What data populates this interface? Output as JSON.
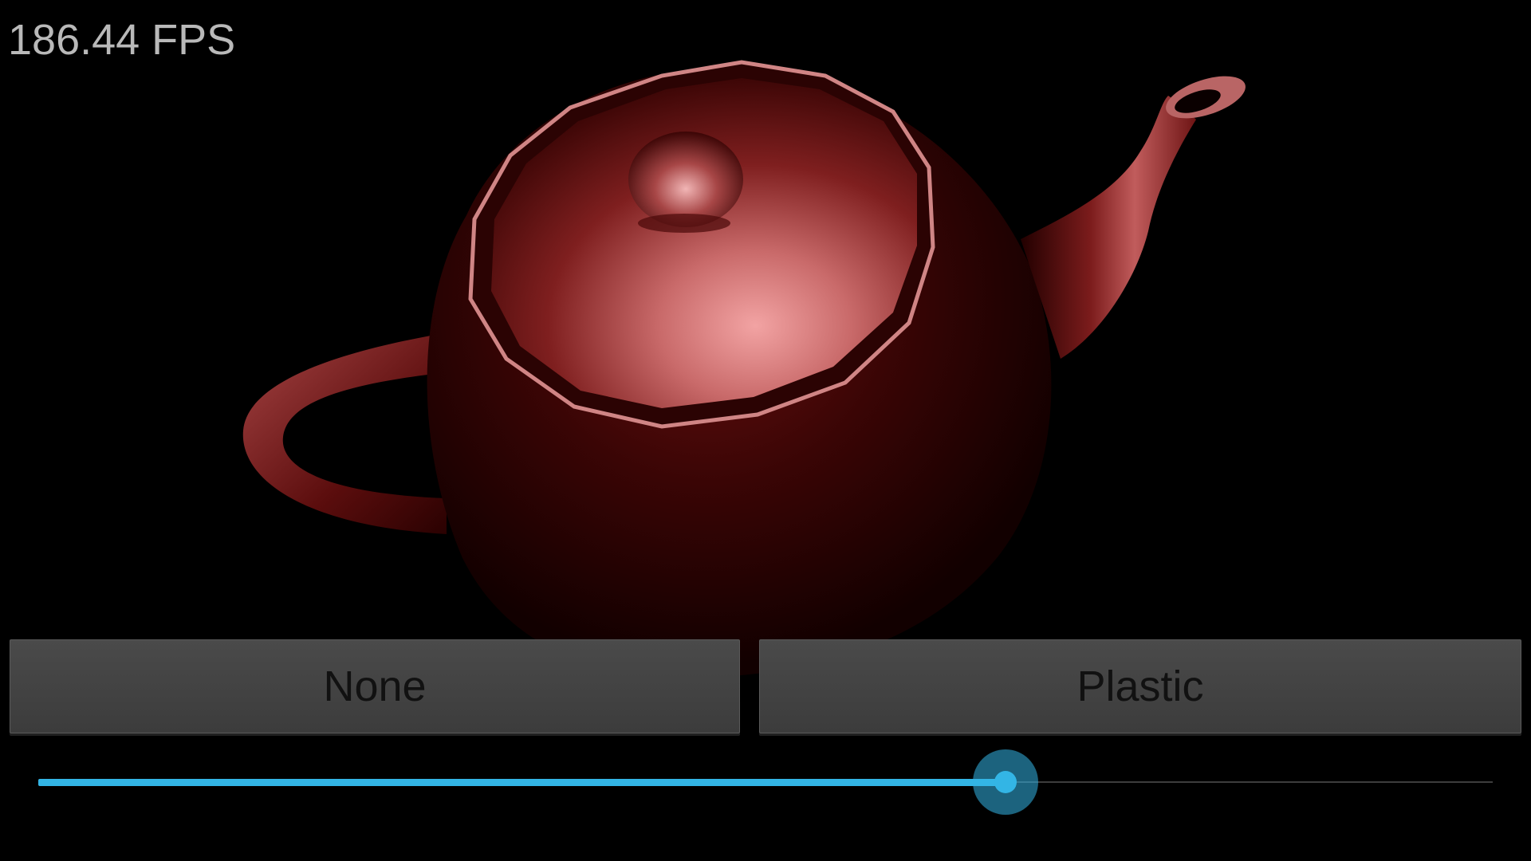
{
  "fps_label": "186.44 FPS",
  "buttons": {
    "left_label": "None",
    "right_label": "Plastic"
  },
  "slider": {
    "value_fraction": 0.665
  },
  "colors": {
    "background": "#000000",
    "teapot": "#6b1212",
    "accent": "#33b5e5",
    "button_bg": "#414141",
    "fps_text": "#b9b9b9"
  },
  "icons": {
    "teapot": "teapot-render"
  }
}
